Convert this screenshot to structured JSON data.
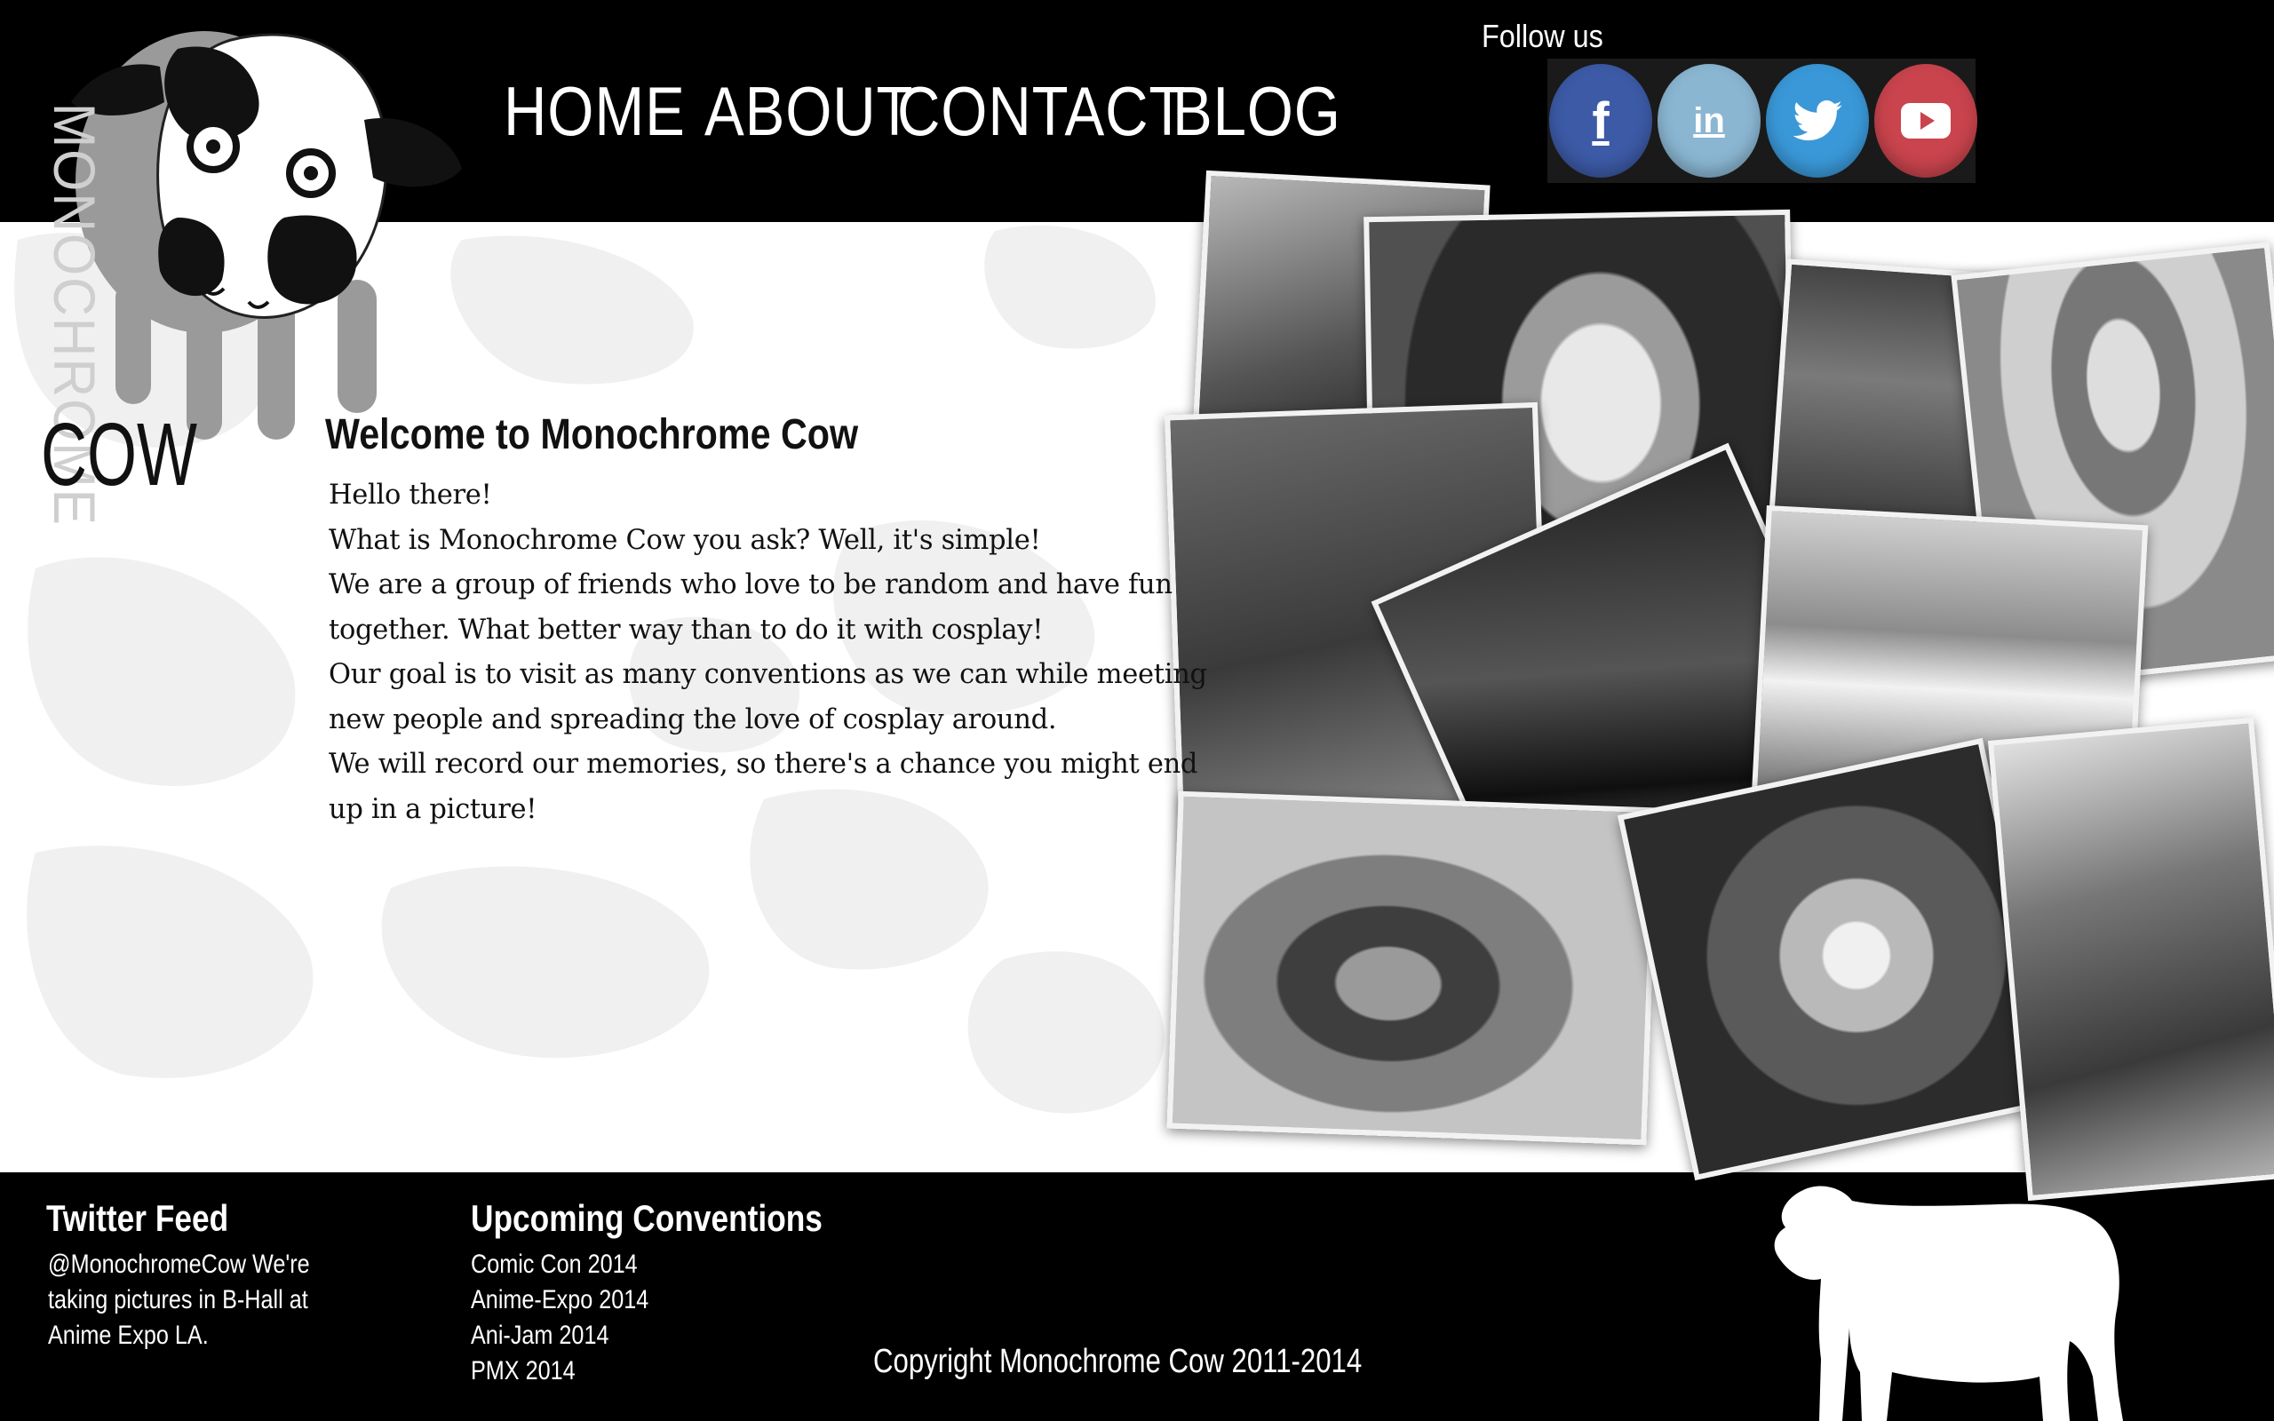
{
  "logo": {
    "vertical_word": "MONOCHROME",
    "word": "COW"
  },
  "nav": {
    "items": [
      {
        "label": "HOME"
      },
      {
        "label": "ABOUT"
      },
      {
        "label": "CONTACT"
      },
      {
        "label": "BLOG"
      }
    ]
  },
  "social": {
    "label": "Follow us",
    "buttons": [
      {
        "icon": "facebook-icon",
        "glyph": "f",
        "color": "#3b5aa8"
      },
      {
        "icon": "linkedin-icon",
        "glyph": "in",
        "color": "#7fb0cf"
      },
      {
        "icon": "twitter-icon",
        "glyph": "🐦",
        "color": "#3b99d8"
      },
      {
        "icon": "youtube-icon",
        "glyph": "▶",
        "color": "#c9434c"
      }
    ]
  },
  "main": {
    "title": "Welcome to Monochrome Cow",
    "lines": [
      "Hello there!",
      "What is Monochrome Cow you ask? Well, it's simple!",
      "We are a group of friends who love to be random and have fun",
      "together. What better way than to do it with cosplay!",
      "Our goal is to visit as many conventions as we can while meeting",
      "new people and spreading the love of cosplay around.",
      "We will record our memories, so there's a chance you might end",
      "up in a picture!"
    ]
  },
  "footer": {
    "twitter": {
      "heading": "Twitter Feed",
      "lines": [
        "@MonochromeCow We're",
        "taking pictures in B-Hall at",
        "Anime Expo LA."
      ]
    },
    "conventions": {
      "heading": "Upcoming Conventions",
      "items": [
        "Comic Con 2014",
        "Anime-Expo 2014",
        "Ani-Jam 2014",
        "PMX 2014"
      ]
    },
    "copyright": "Copyright Monochrome Cow 2011-2014"
  },
  "colors": {
    "header_bg": "#000000",
    "footer_bg": "#000000",
    "page_bg": "#ffffff",
    "spots": "#efefef"
  }
}
